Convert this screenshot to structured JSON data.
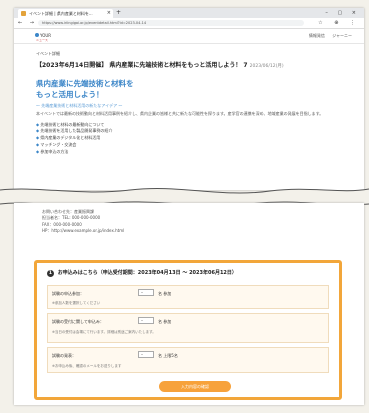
{
  "browser": {
    "tab_title": "イベント詳細 | 県内産業と材料を...",
    "tab_close": "×",
    "new_tab": "+",
    "window_controls": "– ▢ ×",
    "nav_symbols": "← → C",
    "url": "https://www.iriingigai.or.jp/eventdetail.html?id=2023-04-14",
    "tool_symbols": "☆ ⊕ ⋮"
  },
  "site": {
    "logo_text": "YOUR",
    "logo_sub": "ニュース",
    "header_links": [
      "情報発信",
      "ジャーニー"
    ]
  },
  "event": {
    "category": "イベント詳細",
    "title": "【2023年6月14日開催】 県内産業に先端技術と材料をもっと活用しよう！ 7",
    "date": "2023/06/12(月)",
    "hero_line1": "県内産業に先端技術と材料を",
    "hero_line2": "もっと活用しよう！",
    "subtitle": "～ 先端産業技術と材料活用の新たなアイデア ～",
    "paragraph": "本イベントでは最新の技術動向と材料活用事例を紹介し、県内企業の皆様と共に新たな可能性を探ります。産学官の連携を深め、地域産業の発展を目指します。",
    "bullets": [
      "先端技術と材料の最新動向について",
      "先端技術を活用した製品開発事例の紹介",
      "県内産業のデジタル化と材料活用",
      "マッチング・交流会",
      "参加申込の方法"
    ]
  },
  "contact": {
    "lines": [
      "お問い合わせ先：産業振興課",
      "担当者名：TEL: 000-000-0000",
      "FAX：000-000-0000",
      "HP：http://www.example.or.jp/index.html"
    ]
  },
  "form": {
    "number": "1",
    "heading": "お申込みはこちら（申込受付期間：2023年04月13日 ～ 2023年06月12日）",
    "rows": [
      {
        "label": "試験の申込参加：",
        "select": "–",
        "unit": "名 参加",
        "note": "※参加人数を選択してください"
      },
      {
        "label": "試験の受付に関して申込み：",
        "select": "–",
        "unit": "名 参加",
        "note": "※当日の受付は会場にて行います。詳細は別途ご案内いたします。"
      },
      {
        "label": "試験の発表：",
        "select": "–",
        "unit": "名 上限5名",
        "note": "※お申込み後、確認のメールをお送りします"
      }
    ],
    "submit_label": "入力内容の確認"
  },
  "colors": {
    "accent": "#f2a63a",
    "link_blue": "#3c86c8"
  }
}
